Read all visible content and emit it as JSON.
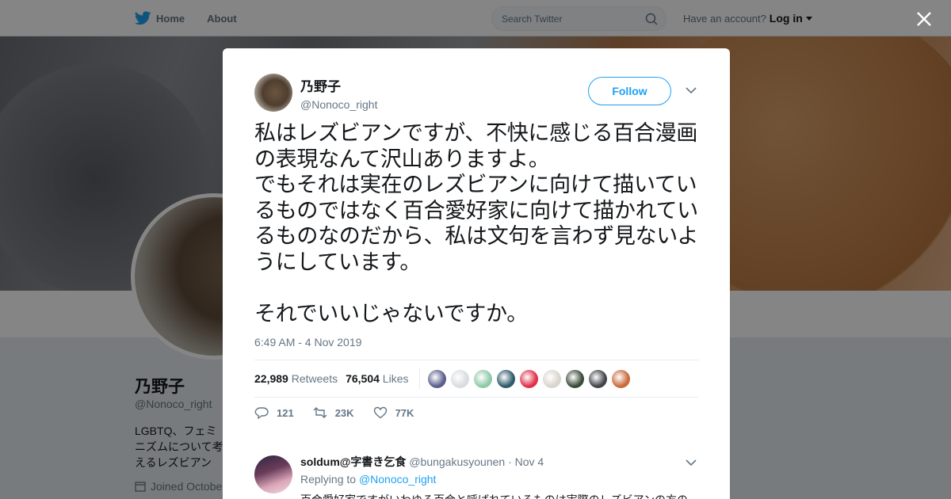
{
  "nav": {
    "home_label": "Home",
    "about_label": "About",
    "search_placeholder": "Search Twitter",
    "account_prompt": "Have an account?",
    "login_label": "Log in"
  },
  "profile": {
    "name": "乃野子",
    "handle": "@Nonoco_right",
    "bio": "LGBTQ、フェミニズムについて考えるレズビアンめ。",
    "joined": "Joined October"
  },
  "tweet": {
    "author_name": "乃野子",
    "author_handle": "@Nonoco_right",
    "follow_label": "Follow",
    "text": "私はレズビアンですが、不快に感じる百合漫画の表現なんて沢山ありますよ。\nでもそれは実在のレズビアンに向けて描いているものではなく百合愛好家に向けて描かれているものなのだから、私は文句を言わず見ないようにしています。\n\nそれでいいじゃないですか。",
    "timestamp": "6:49 AM - 4 Nov 2019",
    "retweets_count": "22,989",
    "retweets_label": "Retweets",
    "likes_count": "76,504",
    "likes_label": "Likes",
    "reply_count": "121",
    "retweet_action_count": "23K",
    "like_action_count": "77K",
    "liker_colors": [
      "#5a5f8a",
      "#d8dbe0",
      "#8fc9a8",
      "#2e5a6a",
      "#e0304a",
      "#d9d4cc",
      "#3a4a3a",
      "#404448",
      "#c86a3a"
    ]
  },
  "reply": {
    "name": "soldum@字書き乞食",
    "handle": "@bungakusyounen",
    "date": "Nov 4",
    "replying_prefix": "Replying to",
    "replying_to": "@Nonoco_right",
    "text": "百合愛好家ですがいわゆる百合と呼ばれているものは実際のレズビアンの方の"
  },
  "colors": {
    "accent": "#1da1f2",
    "text": "#14171a",
    "muted": "#657786"
  }
}
